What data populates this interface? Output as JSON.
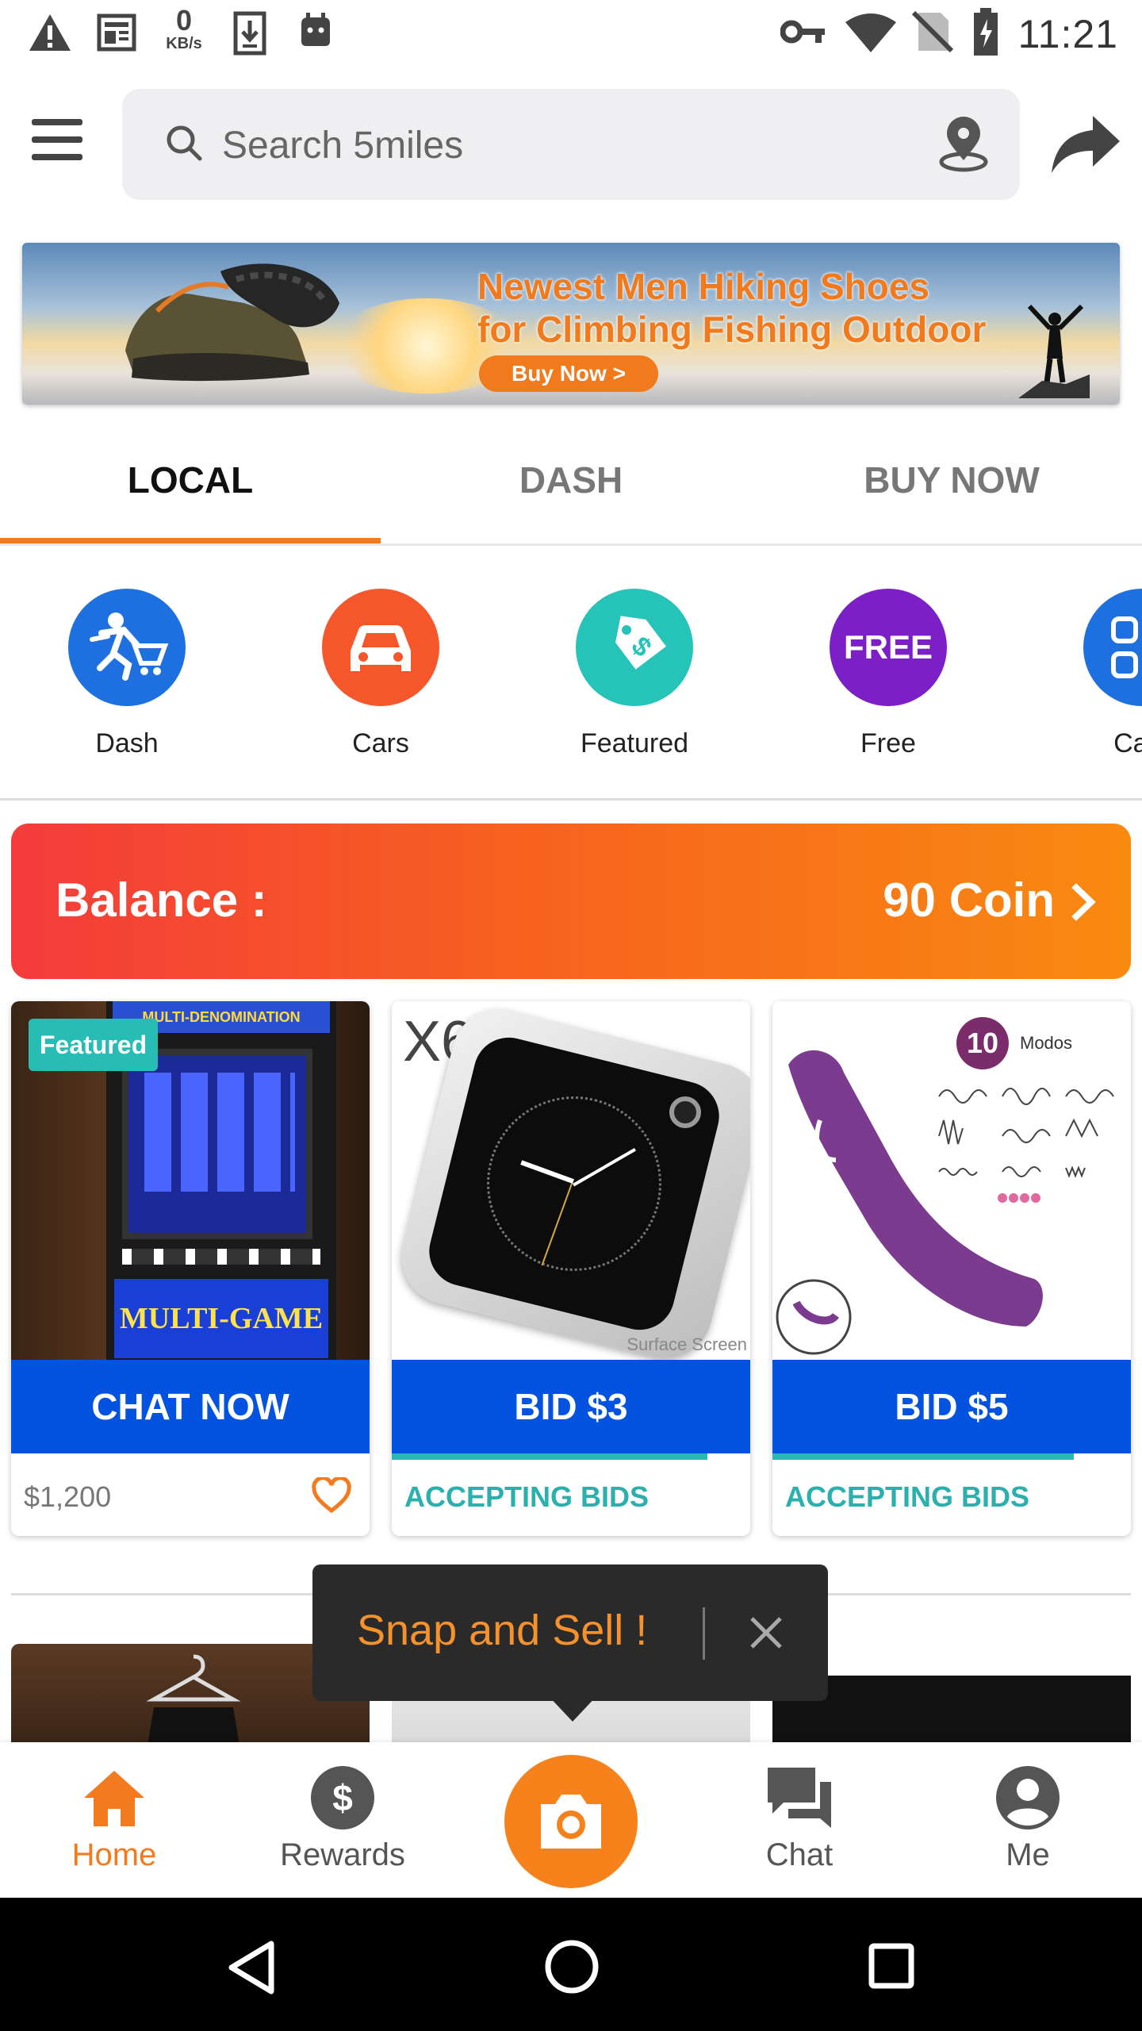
{
  "status_bar": {
    "time": "11:21",
    "net_speed_value": "0",
    "net_speed_unit": "KB/s"
  },
  "search": {
    "placeholder": "Search 5miles"
  },
  "banner": {
    "title_line1": "Newest Men Hiking Shoes",
    "title_line2": "for Climbing Fishing Outdoor",
    "cta": "Buy Now >"
  },
  "tabs": [
    {
      "label": "LOCAL",
      "active": true
    },
    {
      "label": "DASH",
      "active": false
    },
    {
      "label": "BUY NOW",
      "active": false
    }
  ],
  "categories": [
    {
      "label": "Dash",
      "icon": "dash-cart-icon",
      "color": "#1e6fe0"
    },
    {
      "label": "Cars",
      "icon": "car-icon",
      "color": "#f5572a"
    },
    {
      "label": "Featured",
      "icon": "price-tag-icon",
      "color": "#25c3b8"
    },
    {
      "label": "Free",
      "icon": "free-icon",
      "icon_text": "FREE",
      "color": "#7d1fc6"
    },
    {
      "label": "Cate",
      "icon": "categories-icon",
      "color": "#1e6fe0"
    }
  ],
  "balance": {
    "label": "Balance :",
    "value": "90 Coin"
  },
  "products": [
    {
      "badge": "Featured",
      "button": "CHAT NOW",
      "footer": "$1,200",
      "image_text_top": "MULTI-DENOMINATION",
      "image_text_bottom": "MULTI-GAME"
    },
    {
      "button": "BID $3",
      "footer": "ACCEPTING BIDS",
      "progress": 0.88,
      "image_text_brand": "X6",
      "image_text_sub": "Surface Screen"
    },
    {
      "button": "BID $5",
      "footer": "ACCEPTING BIDS",
      "progress": 0.84,
      "image_text_num": "10",
      "image_text_modes": "Modos"
    }
  ],
  "snap_tooltip": {
    "text": "Snap and Sell !"
  },
  "bottom_nav": [
    {
      "label": "Home",
      "icon": "home-icon",
      "active": true
    },
    {
      "label": "Rewards",
      "icon": "rewards-icon",
      "active": false
    },
    {
      "label": "",
      "icon": "camera-icon",
      "active": false
    },
    {
      "label": "Chat",
      "icon": "chat-icon",
      "active": false
    },
    {
      "label": "Me",
      "icon": "profile-icon",
      "active": false
    }
  ],
  "colors": {
    "accent": "#f37a1f",
    "button_blue": "#0453e0",
    "teal": "#2bb0ae"
  }
}
